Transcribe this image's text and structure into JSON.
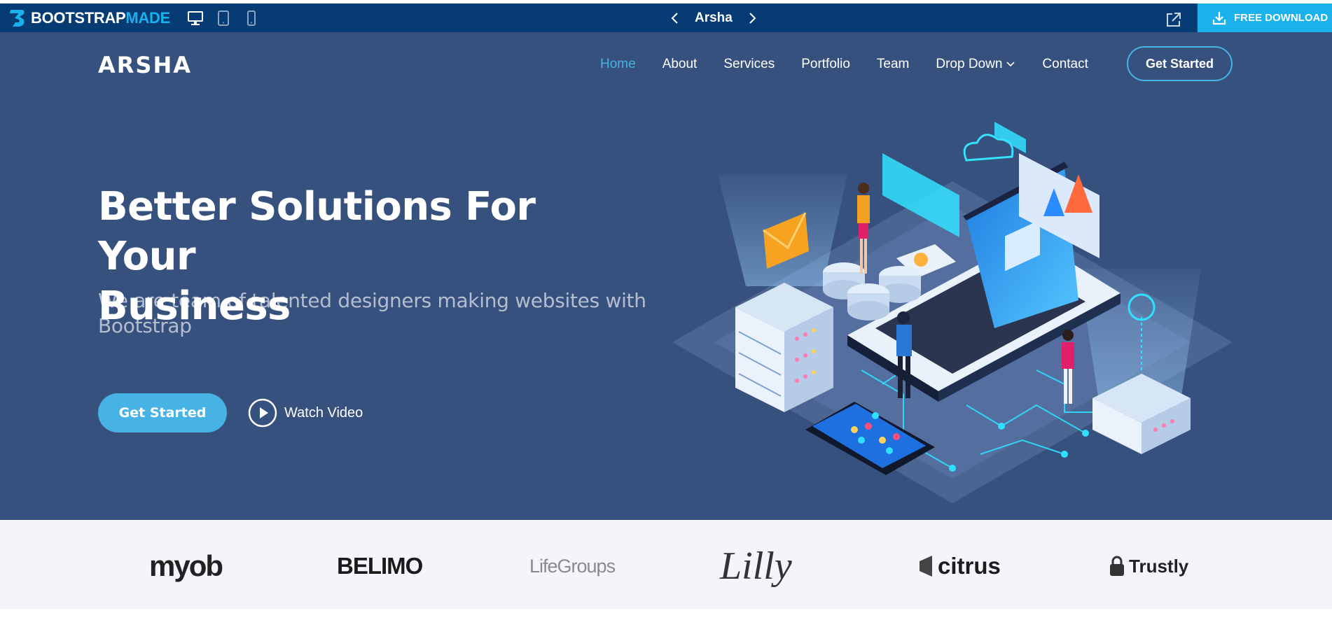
{
  "preview_bar": {
    "brand_part1": "BOOTSTRAP",
    "brand_part2": "MADE",
    "template_name": "Arsha",
    "download_label": "FREE DOWNLOAD",
    "device_icons": [
      "desktop-icon",
      "tablet-icon",
      "mobile-icon"
    ],
    "colors": {
      "bar": "#063b73",
      "accent": "#1ab2ec"
    }
  },
  "header": {
    "logo": "ARSHA",
    "nav": [
      {
        "label": "Home",
        "active": true
      },
      {
        "label": "About"
      },
      {
        "label": "Services"
      },
      {
        "label": "Portfolio"
      },
      {
        "label": "Team"
      },
      {
        "label": "Drop Down",
        "dropdown": true
      },
      {
        "label": "Contact"
      }
    ],
    "cta": "Get Started"
  },
  "hero": {
    "title_line1": "Better Solutions For Your",
    "title_line2": "Business",
    "subtitle": "We are team of talented designers making websites with Bootstrap",
    "primary_button": "Get Started",
    "video_button": "Watch Video",
    "colors": {
      "background": "#37517e",
      "accent": "#47b2e4"
    }
  },
  "clients": {
    "logos": [
      "myob",
      "BELIMO",
      "LifeGroups",
      "Lilly",
      "citrus",
      "Trustly"
    ],
    "background": "#f3f5fa"
  }
}
